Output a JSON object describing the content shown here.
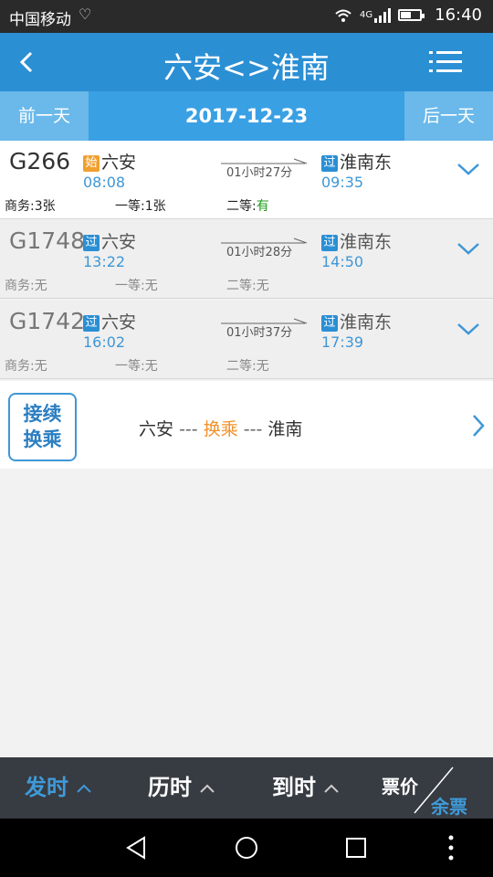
{
  "status": {
    "carrier": "中国移动",
    "network": "4G",
    "time": "16:40",
    "battery_level": 0.55,
    "icons": [
      "heart-icon",
      "wifi-icon",
      "signal-icon",
      "battery-icon"
    ]
  },
  "header": {
    "title": "六安<>淮南",
    "icons": [
      "back-arrow-icon",
      "menu-icon"
    ]
  },
  "date_bar": {
    "prev_label": "前一天",
    "date": "2017-12-23",
    "next_label": "后一天"
  },
  "trains": [
    {
      "code": "G266",
      "from_badge": "始",
      "from": "六安",
      "dep": "08:08",
      "duration": "01小时27分",
      "to_badge": "过",
      "to": "淮南东",
      "arr": "09:35",
      "business": "商务:3张",
      "first": "一等:1张",
      "second_label": "二等:",
      "second_value": "有"
    },
    {
      "code": "G1748",
      "from_badge": "过",
      "from": "六安",
      "dep": "13:22",
      "duration": "01小时28分",
      "to_badge": "过",
      "to": "淮南东",
      "arr": "14:50",
      "business": "商务:无",
      "first": "一等:无",
      "second_label": "二等:",
      "second_value": "无"
    },
    {
      "code": "G1742",
      "from_badge": "过",
      "from": "六安",
      "dep": "16:02",
      "duration": "01小时37分",
      "to_badge": "过",
      "to": "淮南东",
      "arr": "17:39",
      "business": "商务:无",
      "first": "一等:无",
      "second_label": "二等:",
      "second_value": "无"
    }
  ],
  "transfer": {
    "button_line1": "接续",
    "button_line2": "换乘",
    "from": "六安",
    "sep": "---",
    "mid": "换乘",
    "to": "淮南"
  },
  "sort_bar": {
    "depart": "发时",
    "duration": "历时",
    "arrive": "到时",
    "price": "票价",
    "remain": "余票"
  },
  "colors": {
    "primary": "#2b8fd4",
    "accent_orange": "#f0922a",
    "available_green": "#1a9b1a"
  }
}
